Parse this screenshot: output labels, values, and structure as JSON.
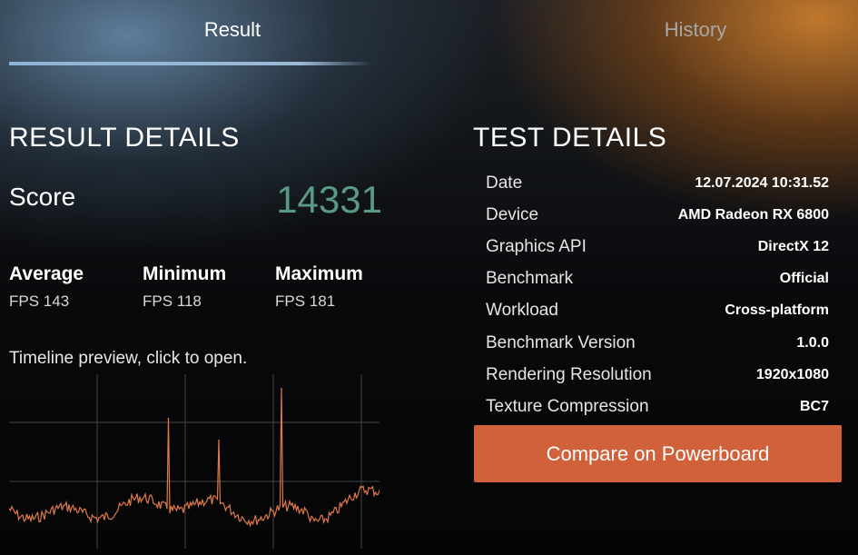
{
  "tabs": {
    "result": {
      "label": "Result",
      "color": "#ffffff"
    },
    "history": {
      "label": "History",
      "color": "#a7a7a7"
    }
  },
  "result": {
    "title": "RESULT DETAILS",
    "score_label": "Score",
    "score_value": "14331",
    "stats": [
      {
        "label": "Average",
        "value": "FPS 143"
      },
      {
        "label": "Minimum",
        "value": "FPS 118"
      },
      {
        "label": "Maximum",
        "value": "FPS 181"
      }
    ],
    "timeline_caption": "Timeline preview, click to open."
  },
  "test": {
    "title": "TEST DETAILS",
    "rows": [
      {
        "label": "Date",
        "value": "12.07.2024 10:31.52"
      },
      {
        "label": "Device",
        "value": "AMD Radeon RX 6800"
      },
      {
        "label": "Graphics API",
        "value": "DirectX 12"
      },
      {
        "label": "Benchmark",
        "value": "Official"
      },
      {
        "label": "Workload",
        "value": "Cross-platform"
      },
      {
        "label": "Benchmark Version",
        "value": "1.0.0"
      },
      {
        "label": "Rendering Resolution",
        "value": "1920x1080"
      },
      {
        "label": "Texture Compression",
        "value": "BC7"
      }
    ],
    "compare_button": "Compare on Powerboard"
  },
  "colors": {
    "accent_orange": "#d0613a",
    "score_green": "#5a9a84",
    "timeline_line": "#e07a4a",
    "active_tab_underline": "#8fb3d6"
  }
}
